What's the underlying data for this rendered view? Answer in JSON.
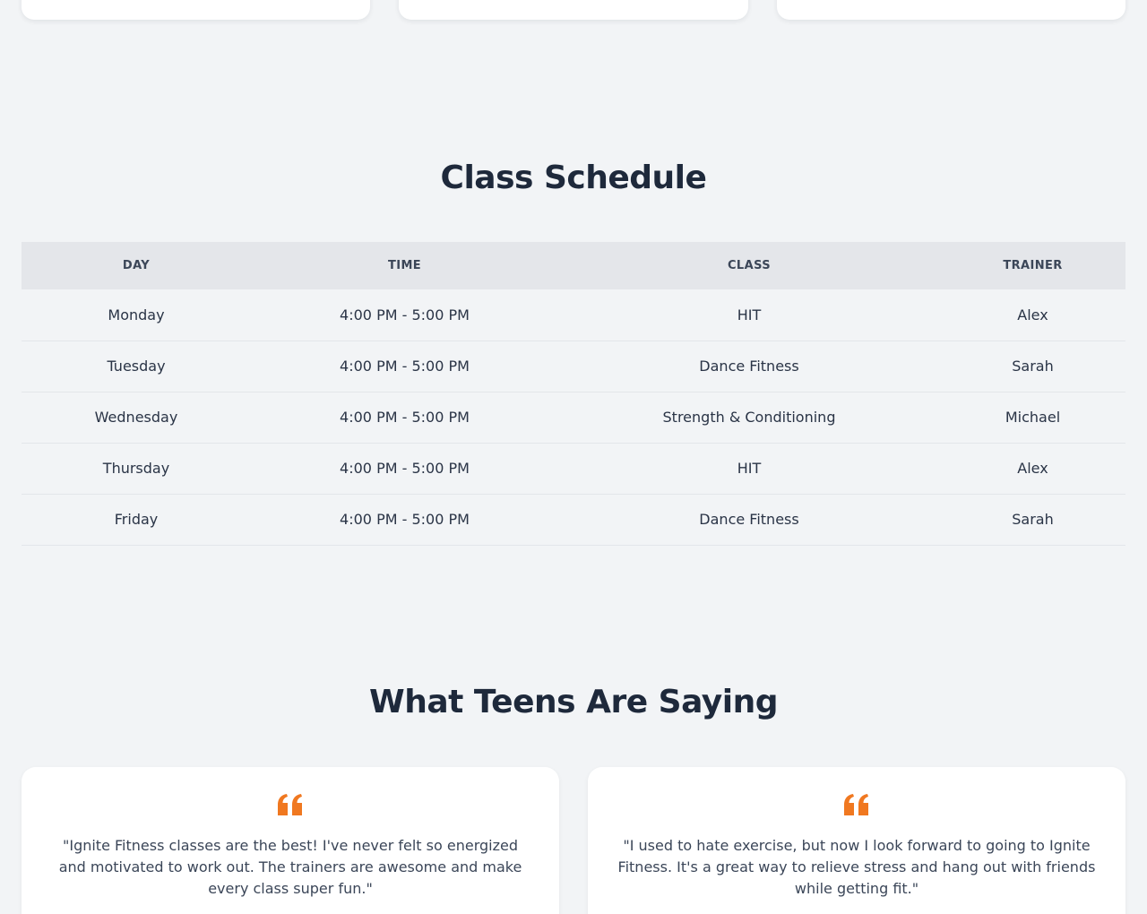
{
  "schedule": {
    "title": "Class Schedule",
    "headers": [
      "DAY",
      "TIME",
      "CLASS",
      "TRAINER"
    ],
    "rows": [
      {
        "day": "Monday",
        "time": "4:00 PM - 5:00 PM",
        "class": "HIT",
        "trainer": "Alex"
      },
      {
        "day": "Tuesday",
        "time": "4:00 PM - 5:00 PM",
        "class": "Dance Fitness",
        "trainer": "Sarah"
      },
      {
        "day": "Wednesday",
        "time": "4:00 PM - 5:00 PM",
        "class": "Strength & Conditioning",
        "trainer": "Michael"
      },
      {
        "day": "Thursday",
        "time": "4:00 PM - 5:00 PM",
        "class": "HIT",
        "trainer": "Alex"
      },
      {
        "day": "Friday",
        "time": "4:00 PM - 5:00 PM",
        "class": "Dance Fitness",
        "trainer": "Sarah"
      }
    ]
  },
  "testimonials": {
    "title": "What Teens Are Saying",
    "quote_icon": "quote-left-icon",
    "accent_color": "#f07820",
    "items": [
      {
        "text": "\"Ignite Fitness classes are the best! I've never felt so energized and motivated to work out. The trainers are awesome and make every class super fun.\""
      },
      {
        "text": "\"I used to hate exercise, but now I look forward to going to Ignite Fitness. It's a great way to relieve stress and hang out with friends while getting fit.\""
      }
    ]
  }
}
